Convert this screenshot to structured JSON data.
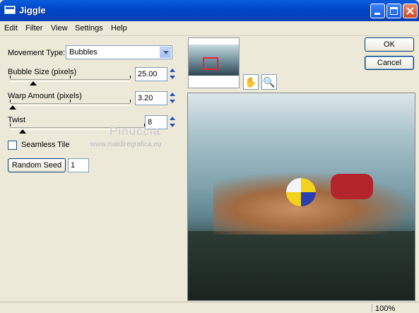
{
  "window": {
    "title": "Jiggle"
  },
  "menu": [
    "Edit",
    "Filter",
    "View",
    "Settings",
    "Help"
  ],
  "controls": {
    "movement_type_label": "Movement Type:",
    "movement_type_value": "Bubbles",
    "bubble_size_label": "Bubble Size (pixels)",
    "bubble_size_value": "25.00",
    "warp_amount_label": "Warp Amount (pixels)",
    "warp_amount_value": "3.20",
    "twist_label": "Twist",
    "twist_value": "8",
    "seamless_tile_label": "Seamless Tile",
    "seamless_tile_checked": false,
    "random_seed_label": "Random Seed",
    "random_seed_value": "1"
  },
  "buttons": {
    "ok": "OK",
    "cancel": "Cancel"
  },
  "watermark": {
    "name": "Pinuccia",
    "site": "www.maidiregrafica.eu"
  },
  "tools": {
    "hand": "✋",
    "zoom": "🔍"
  },
  "status": {
    "zoom": "100%"
  },
  "icons": [
    "app-icon",
    "minimize-icon",
    "maximize-icon",
    "close-icon",
    "dropdown-arrow-icon",
    "spin-up-icon",
    "spin-down-icon",
    "hand-tool-icon",
    "zoom-tool-icon"
  ]
}
